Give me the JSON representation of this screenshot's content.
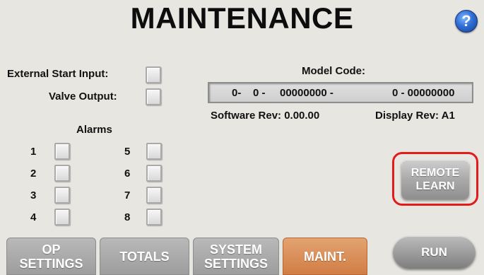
{
  "header": {
    "title": "MAINTENANCE",
    "help_glyph": "?"
  },
  "io": {
    "external_start_label": "External Start Input:",
    "valve_output_label": "Valve Output:"
  },
  "model": {
    "label": "Model Code:",
    "seg1": "0-",
    "seg2": "0 -",
    "seg3": "00000000 -",
    "seg4": "0 - 00000000",
    "software_rev": "Software Rev:  0.00.00",
    "display_rev": "Display Rev: A1"
  },
  "alarms": {
    "title": "Alarms",
    "items": [
      "1",
      "2",
      "3",
      "4",
      "5",
      "6",
      "7",
      "8"
    ]
  },
  "remote_learn": {
    "line1": "REMOTE",
    "line2": "LEARN"
  },
  "tabs": {
    "op_settings_1": "OP",
    "op_settings_2": "SETTINGS",
    "totals": "TOTALS",
    "system_settings_1": "SYSTEM",
    "system_settings_2": "SETTINGS",
    "maint": "MAINT.",
    "run": "RUN"
  },
  "colors": {
    "highlight_border": "#e21b1b",
    "active_tab": "#d17d44",
    "help": "#2f6fd6"
  }
}
